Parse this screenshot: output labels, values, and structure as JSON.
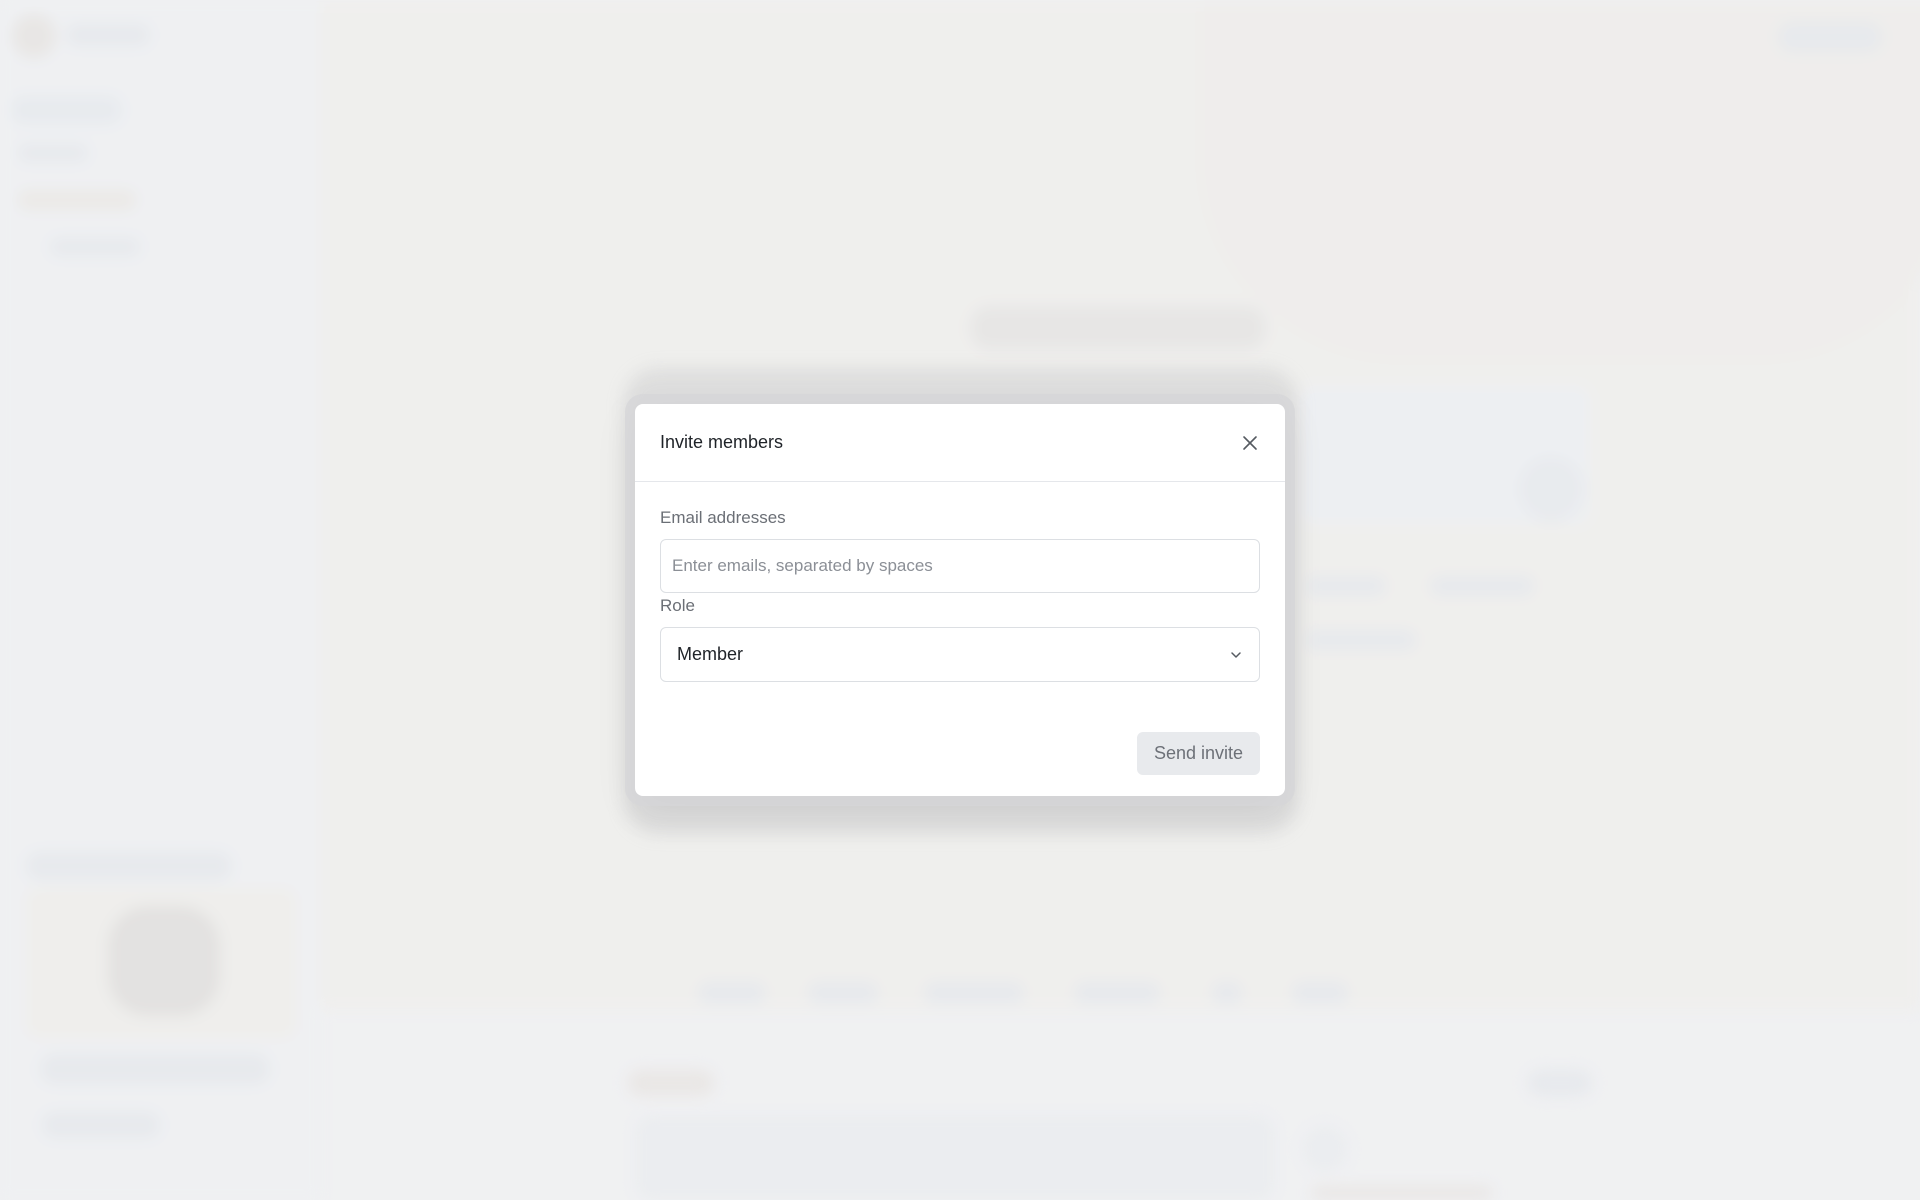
{
  "dialog": {
    "title": "Invite members",
    "email_label": "Email addresses",
    "email_placeholder": "Enter emails, separated by spaces",
    "email_value": "",
    "role_label": "Role",
    "role_value": "Member",
    "submit_label": "Send invite"
  },
  "icons": {
    "close": "close-icon",
    "dropdown": "chevron-down-icon"
  },
  "colors": {
    "page_background": "#f0f1f2",
    "dialog_background": "#ffffff",
    "disabled_button_bg": "#e8eaed",
    "disabled_button_text": "#6d7178"
  }
}
